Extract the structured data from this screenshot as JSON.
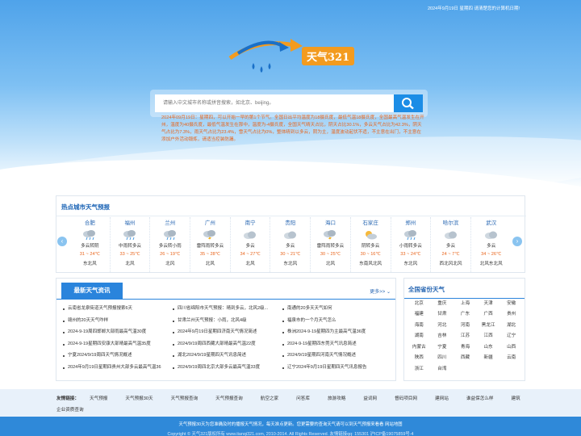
{
  "header": {
    "date_text": "2024年9月19日 星期四 请清楚您的计算机日期!",
    "logo_text": "天气321"
  },
  "search": {
    "placeholder": "请输入中文城市名称或拼音搜索，如北京、beijing。",
    "button_icon": "search-icon"
  },
  "forecast_note": "2024年09月19日：星期四，可以开始一早的第1个节气。全国日出平均温度为18摄氏度，最低气温18摄氏度，全国最高气温发生在开州，温度为40摄氏度，最低气温发生在那中，温度为-4摄氏度，全国天气晴天占比，阴天占比30.1%，多云天气占比为42.3%，阴天气占比为7.3%，雨天气占比为23.4%，雪天气占比为0%，整体晴到以多云，阴为主，温度波动起伏不适，不主意在出门，不主意在添加户外活动锻炼，请适当控装防漏。",
  "hot_cities": {
    "title": "热点城市天气预报",
    "items": [
      {
        "name": "合肥",
        "icon": "cloud-rain-icon",
        "desc": "多云转阴",
        "temp": "31 ~ 24℃",
        "wind": "东北风"
      },
      {
        "name": "福州",
        "icon": "cloud-rain-icon",
        "desc": "中雨转多云",
        "temp": "33 ~ 25℃",
        "wind": "北风"
      },
      {
        "name": "兰州",
        "icon": "cloud-rain-icon",
        "desc": "多云转小雨",
        "temp": "26 ~ 19℃",
        "wind": "北风"
      },
      {
        "name": "广州",
        "icon": "thunderstorm-icon",
        "desc": "雷阵雨转多云",
        "temp": "35 ~ 28℃",
        "wind": "北风"
      },
      {
        "name": "南宁",
        "icon": "cloud-icon",
        "desc": "多云",
        "temp": "34 ~ 27℃",
        "wind": "北风"
      },
      {
        "name": "贵阳",
        "icon": "cloud-icon",
        "desc": "多云",
        "temp": "30 ~ 21℃",
        "wind": "东北风"
      },
      {
        "name": "海口",
        "icon": "thunderstorm-icon",
        "desc": "雷阵雨转多云",
        "temp": "30 ~ 25℃",
        "wind": "北风"
      },
      {
        "name": "石家庄",
        "icon": "sun-cloud-icon",
        "desc": "阴转多云",
        "temp": "30 ~ 16℃",
        "wind": "东南风北风"
      },
      {
        "name": "郑州",
        "icon": "cloud-rain-icon",
        "desc": "小雨转多云",
        "temp": "33 ~ 24℃",
        "wind": "东北风"
      },
      {
        "name": "哈尔滨",
        "icon": "cloud-icon",
        "desc": "多云",
        "temp": "24 ~ 7℃",
        "wind": "西北风北风"
      },
      {
        "name": "武汉",
        "icon": "cloud-icon",
        "desc": "多云",
        "temp": "34 ~ 26℃",
        "wind": "北风东北风"
      }
    ]
  },
  "news": {
    "tab_label": "最新天气资讯",
    "more_label": "更多>> ⌄",
    "items": [
      "云南省龙泉街道天气预报搜索6天",
      "四川省绵阳市天气预报：晴到多云，北风2级...",
      "南通的20多天天气如何",
      "赣州的20天天气咋样",
      "甘肃兰州天气预报：小雨，北风4级",
      "福泉市的一个月天气怎么",
      "2024-9-19周四邯郸大部雨最高气温30度",
      "2024年9月19日星期四济南天气情况简述",
      "株洲2024-9-19星期四为主最高气温36度",
      "2024-9-19星期四安康大部晴最高气温35度",
      "2024/9/19周四西藏大部晴最高气温22度",
      "2024-9-19星期四东莞天气讯息简述",
      "宁夏2024/9/19周四天气情况概述",
      "湖北2024/9/19星期四天气讯息简述",
      "2024/9/19星期四河南天气情况概述",
      "2024年9月19日星期四贵州大部多云最高气温36",
      "2024/9/19周四北京大部多云最高气温33度",
      "辽宁2024年9月19日星期四天气讯息报告"
    ]
  },
  "provinces": {
    "title": "全国省份天气",
    "items": [
      "北京",
      "重庆",
      "上海",
      "天津",
      "安徽",
      "福建",
      "甘肃",
      "广东",
      "广西",
      "贵州",
      "海南",
      "河北",
      "河南",
      "黑龙江",
      "湖北",
      "湖南",
      "吉林",
      "江苏",
      "江西",
      "辽宁",
      "内蒙古",
      "宁夏",
      "青海",
      "山东",
      "山西",
      "陕西",
      "四川",
      "西藏",
      "新疆",
      "云南",
      "浙江",
      "台湾"
    ]
  },
  "friend_links": {
    "label": "友情链接：",
    "items": [
      "天气预报",
      "天气预报30天",
      "天气预报查询",
      "天气预报查询",
      "航空之家",
      "问答库",
      "旅游攻略",
      "益词网",
      "督码项目网",
      "建网站",
      "谁益保怎么样",
      "建筑"
    ],
    "second_row": "企业资质查询"
  },
  "footer": {
    "line1": "天气预报30天为您准确及时的播报天气情况，每天准点更新。您更需要的查询天气请可以到天气预报来看看 网站地图",
    "line2": "Copyright © 天气321版权所有 www.tianqi321.com, 2010-2014. All Rights Reserved. 友情链接qq: 155301 沪ICP备19075859号-4"
  }
}
